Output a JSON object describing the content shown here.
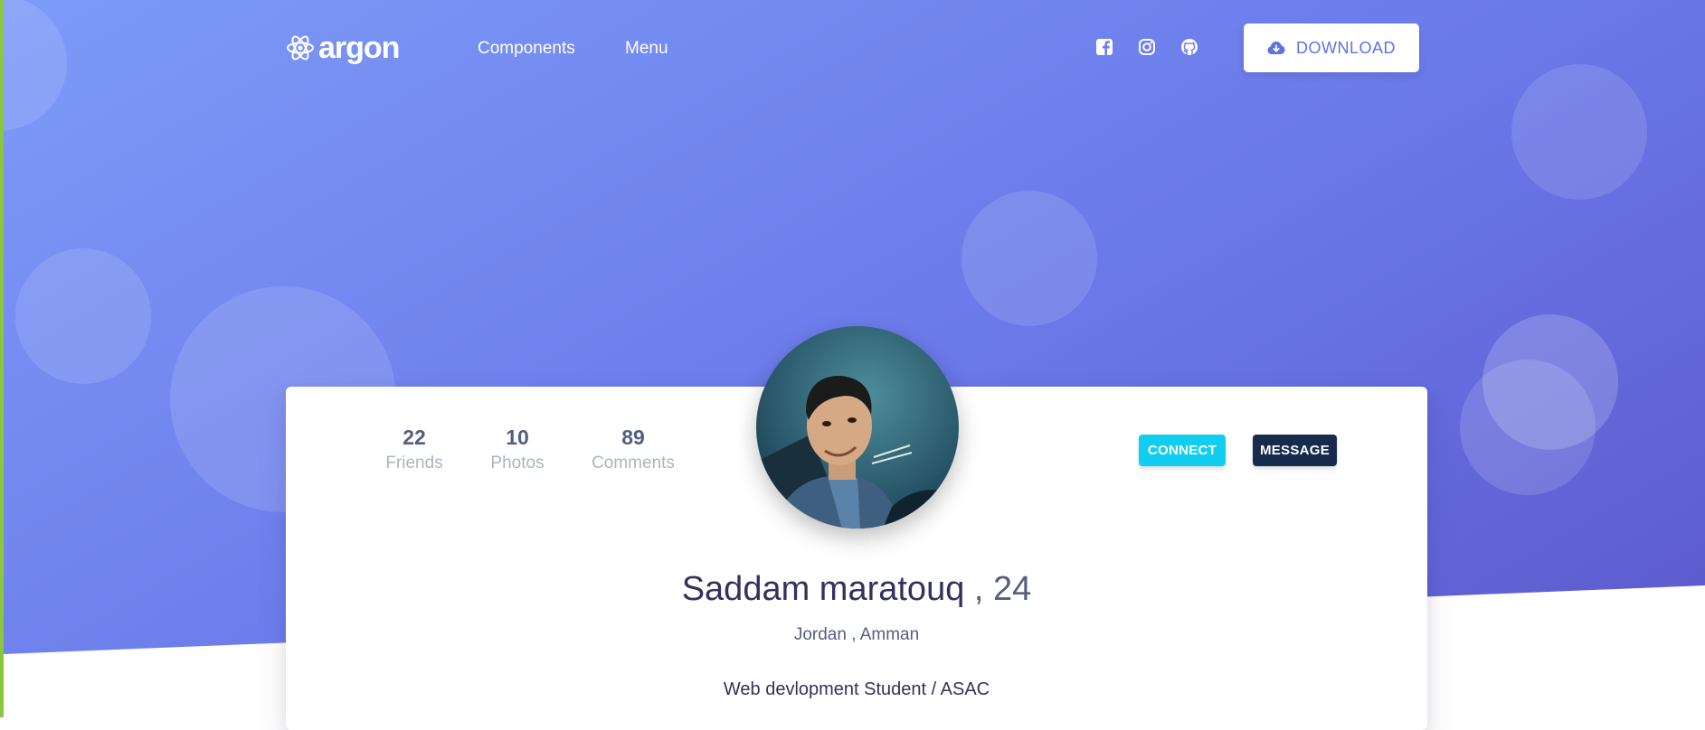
{
  "nav": {
    "brand": "argon",
    "links": [
      "Components",
      "Menu"
    ],
    "social": [
      "facebook-icon",
      "instagram-icon",
      "github-icon"
    ],
    "download_label": "DOWNLOAD"
  },
  "profile": {
    "stats": [
      {
        "value": "22",
        "label": "Friends"
      },
      {
        "value": "10",
        "label": "Photos"
      },
      {
        "value": "89",
        "label": "Comments"
      }
    ],
    "connect_label": "CONNECT",
    "message_label": "MESSAGE",
    "name": "Saddam maratouq",
    "age": ", 24",
    "location": "Jordan , Amman",
    "role": "Web devlopment Student / ASAC"
  },
  "colors": {
    "primary": "#5e72e4",
    "info": "#11cdef",
    "default": "#172b4d",
    "hero_start": "#7d9bf8",
    "hero_end": "#5b57c9"
  }
}
